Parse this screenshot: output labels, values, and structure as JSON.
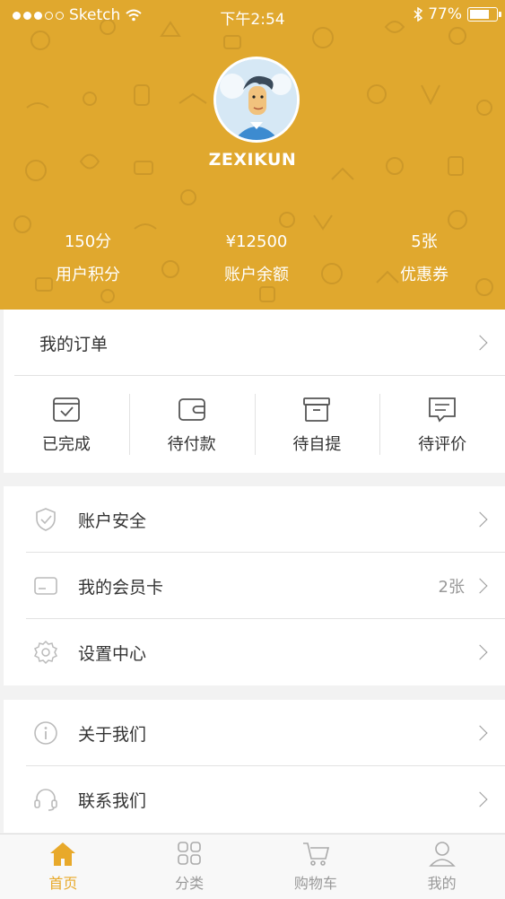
{
  "status_bar": {
    "carrier": "Sketch",
    "time": "下午2:54",
    "battery": "77%"
  },
  "profile": {
    "username": "ZEXIKUN",
    "stats": [
      {
        "value": "150分",
        "label": "用户积分"
      },
      {
        "value": "¥12500",
        "label": "账户余额"
      },
      {
        "value": "5张",
        "label": "优惠券"
      }
    ]
  },
  "orders": {
    "title": "我的订单",
    "items": [
      {
        "label": "已完成",
        "icon": "check-box-icon"
      },
      {
        "label": "待付款",
        "icon": "wallet-icon"
      },
      {
        "label": "待自提",
        "icon": "box-icon"
      },
      {
        "label": "待评价",
        "icon": "comment-icon"
      }
    ]
  },
  "menu_group_1": [
    {
      "label": "账户安全",
      "icon": "shield-icon",
      "extra": ""
    },
    {
      "label": "我的会员卡",
      "icon": "card-icon",
      "extra": "2张"
    },
    {
      "label": "设置中心",
      "icon": "gear-icon",
      "extra": ""
    }
  ],
  "menu_group_2": [
    {
      "label": "关于我们",
      "icon": "info-icon"
    },
    {
      "label": "联系我们",
      "icon": "headset-icon"
    }
  ],
  "tabbar": [
    {
      "label": "首页",
      "icon": "home-icon",
      "active": true
    },
    {
      "label": "分类",
      "icon": "grid-icon",
      "active": false
    },
    {
      "label": "购物车",
      "icon": "cart-icon",
      "active": false
    },
    {
      "label": "我的",
      "icon": "user-icon",
      "active": false
    }
  ],
  "colors": {
    "header_bg": "#e0a82e",
    "accent": "#e8a92a"
  }
}
